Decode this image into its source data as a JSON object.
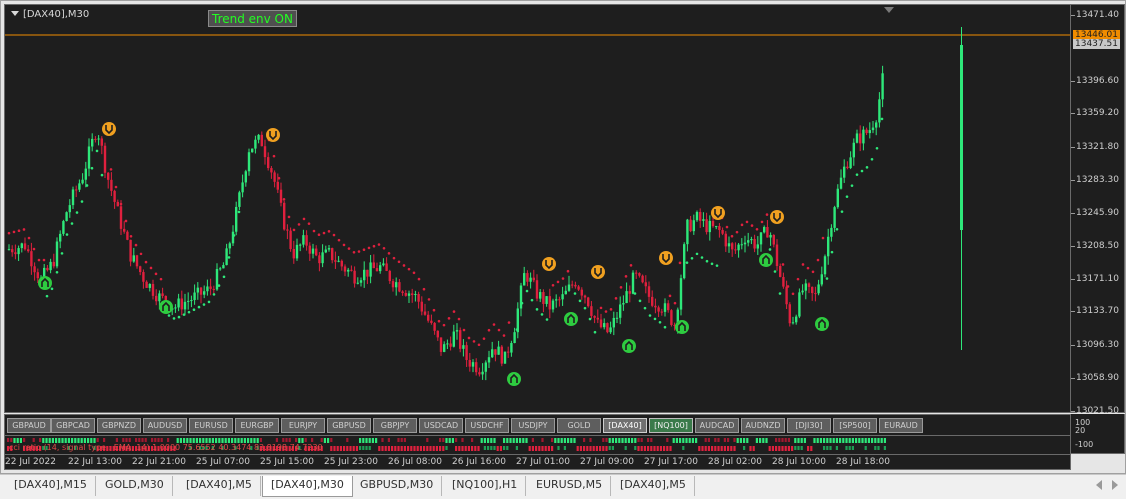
{
  "chart": {
    "title": "[DAX40],M30",
    "trend_label": "Trend env ON",
    "colors": {
      "background": "#1e1e1e",
      "bull": "#2ee87a",
      "bear": "#e0203e",
      "signal_icon": "#f0a020",
      "signal_up_icon": "#2ecc40",
      "current_price_line": "#f08c00"
    },
    "price_axis": {
      "labels": [
        "13471.40",
        "13446.01",
        "13437.51",
        "13396.60",
        "13359.20",
        "13321.80",
        "13283.30",
        "13245.90",
        "13208.50",
        "13171.10",
        "13133.70",
        "13096.30",
        "13058.90",
        "13021.50"
      ],
      "current_price": "13446.01",
      "bid_price": "13437.51"
    },
    "time_axis": {
      "labels": [
        "22 Jul 2022",
        "22 Jul 13:00",
        "22 Jul 21:00",
        "25 Jul 07:00",
        "25 Jul 15:00",
        "25 Jul 23:00",
        "26 Jul 08:00",
        "26 Jul 16:00",
        "27 Jul 01:00",
        "27 Jul 09:00",
        "27 Jul 17:00",
        "28 Jul 02:00",
        "28 Jul 10:00",
        "28 Jul 18:00"
      ]
    }
  },
  "symbols_bar": {
    "buttons": [
      "GBPAUD",
      "GBPCAD",
      "GBPNZD",
      "AUDUSD",
      "EURUSD",
      "EURGBP",
      "EURJPY",
      "GBPUSD",
      "GBPJPY",
      "USDCAD",
      "USDCHF",
      "USDJPY",
      "GOLD",
      "[DAX40]",
      "[NQ100]",
      "AUDCAD",
      "AUDNZD",
      "[DJI30]",
      "[SP500]",
      "EURAUD"
    ],
    "current": "[DAX40]",
    "active": "[NQ100]"
  },
  "indicator": {
    "label": "cci ratio (14, signal type : EMA, 14) 1.0000 75.6552 40.3474 83.8198 74.7230",
    "axis_labels": [
      "100",
      "20",
      "-100"
    ]
  },
  "tabs": {
    "items": [
      "[DAX40],M15",
      "GOLD,M30",
      "[DAX40],M5",
      "[DAX40],M30",
      "GBPUSD,M30",
      "[NQ100],H1",
      "EURUSD,M5",
      "[DAX40],M5"
    ],
    "active": "[DAX40],M30"
  }
}
